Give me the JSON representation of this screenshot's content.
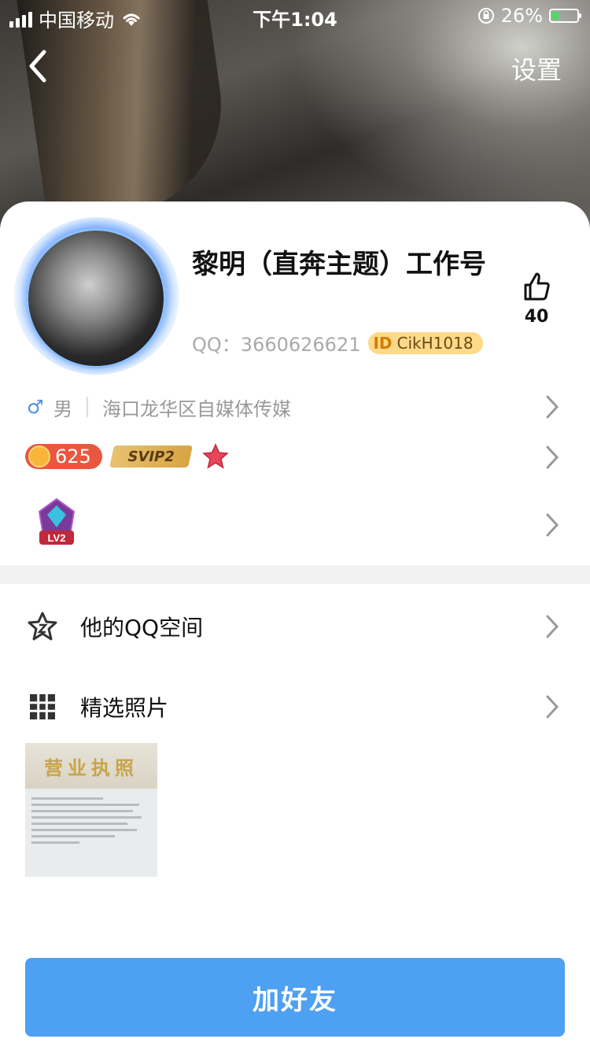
{
  "status_bar": {
    "carrier": "中国移动",
    "time": "下午1:04",
    "battery": "26%"
  },
  "nav": {
    "settings": "设置"
  },
  "profile": {
    "name": "黎明（直奔主题）工作号",
    "qq_label": "QQ：",
    "qq_number": "3660626621",
    "id_badge_prefix": "ID",
    "id_badge": "CikH1018",
    "likes": "40"
  },
  "info": {
    "gender": "男",
    "location": "海口龙华区自媒体传媒"
  },
  "badges": {
    "coin_count": "625",
    "svip": "SVIP2",
    "level": "LV2"
  },
  "menu": {
    "qzone": "他的QQ空间",
    "photos": "精选照片"
  },
  "photo": {
    "title": "营业执照"
  },
  "add_friend": "加好友",
  "colors": {
    "accent": "#4da0f2",
    "gender": "#4a90e2",
    "coin": "#e9573f"
  }
}
